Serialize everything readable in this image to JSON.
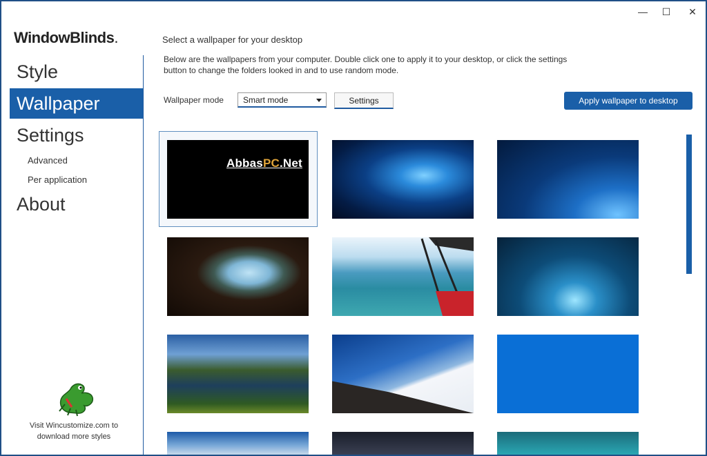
{
  "window": {
    "minimize_glyph": "—",
    "maximize_glyph": "☐",
    "close_glyph": "✕"
  },
  "sidebar": {
    "logo": "WindowBlinds",
    "logo_mark": ".",
    "nav": [
      {
        "label": "Style",
        "active": false
      },
      {
        "label": "Wallpaper",
        "active": true
      },
      {
        "label": "Settings",
        "active": false
      }
    ],
    "sub_items": [
      "Advanced",
      "Per application"
    ],
    "about": "About",
    "visit_line1": "Visit Wincustomize.com to",
    "visit_line2": "download more styles"
  },
  "main": {
    "heading": "Select a wallpaper for your desktop",
    "description": "Below are the wallpapers from your computer.  Double click one to apply it to your desktop, or click the settings button to change the folders looked in and to use random mode.",
    "mode_label": "Wallpaper mode",
    "mode_value": "Smart mode",
    "settings_button": "Settings",
    "apply_button": "Apply wallpaper to desktop"
  },
  "watermark": {
    "part1": "Abbas",
    "part2": "PC",
    "part3": ".Net"
  },
  "wallpapers": [
    {
      "name": "black-abbaspc",
      "selected": true
    },
    {
      "name": "windows-10-hero-1",
      "selected": false
    },
    {
      "name": "windows-10-hero-2",
      "selected": false
    },
    {
      "name": "beach-cave",
      "selected": false
    },
    {
      "name": "seaplane-view",
      "selected": false
    },
    {
      "name": "ice-cave",
      "selected": false
    },
    {
      "name": "mountain-lake",
      "selected": false
    },
    {
      "name": "hill-over-clouds",
      "selected": false
    },
    {
      "name": "solid-blue",
      "selected": false
    },
    {
      "name": "row4-sky",
      "selected": false
    },
    {
      "name": "row4-night",
      "selected": false
    },
    {
      "name": "row4-wave",
      "selected": false
    }
  ],
  "colors": {
    "accent": "#1a5fa8",
    "border": "#1f4f86"
  }
}
